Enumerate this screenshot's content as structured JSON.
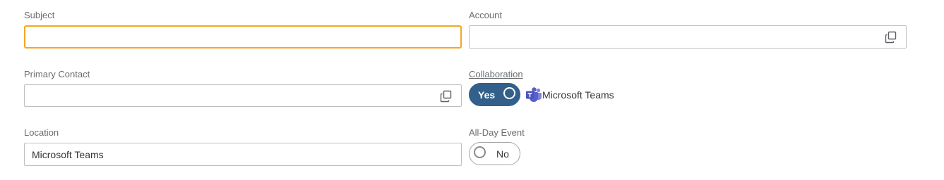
{
  "fields": {
    "subject": {
      "label": "Subject",
      "value": ""
    },
    "account": {
      "label": "Account",
      "value": ""
    },
    "primary_contact": {
      "label": "Primary Contact",
      "value": ""
    },
    "collaboration": {
      "label": "Collaboration",
      "toggle_state": "on",
      "toggle_text": "Yes",
      "provider_icon": "microsoft-teams-icon",
      "provider_label": "Microsoft Teams"
    },
    "location": {
      "label": "Location",
      "value": "Microsoft Teams"
    },
    "all_day_event": {
      "label": "All-Day Event",
      "toggle_state": "off",
      "toggle_text": "No"
    }
  },
  "icons": {
    "value_help": "value-help-icon"
  },
  "colors": {
    "focus_border": "#f5a623",
    "toggle_on": "#32608a",
    "teams_purple": "#5b5fc7"
  }
}
